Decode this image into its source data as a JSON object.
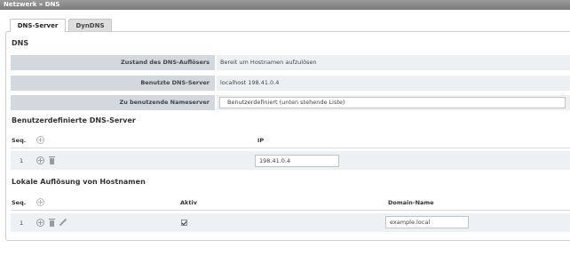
{
  "breadcrumb": "Netzwerk » DNS",
  "tabs": [
    {
      "label": "DNS-Server",
      "active": true
    },
    {
      "label": "DynDNS",
      "active": false
    }
  ],
  "dns": {
    "heading": "DNS",
    "rows": [
      {
        "label": "Zustand des DNS-Auflösers",
        "value": "Bereit um Hostnamen aufzulösen"
      },
      {
        "label": "Benutzte DNS-Server",
        "value": "localhost 198.41.0.4"
      },
      {
        "label": "Zu benutzende Nameserver",
        "value": "Benutzerdefiniert (unten stehende Liste)"
      }
    ]
  },
  "custom_servers": {
    "heading": "Benutzerdefinierte DNS-Server",
    "columns": {
      "seq": "Seq.",
      "ip": "IP"
    },
    "rows": [
      {
        "seq": "1",
        "ip": "198.41.0.4"
      }
    ]
  },
  "local_resolution": {
    "heading": "Lokale Auflösung von Hostnamen",
    "columns": {
      "seq": "Seq.",
      "active": "Aktiv",
      "domain": "Domain-Name"
    },
    "rows": [
      {
        "seq": "1",
        "active": true,
        "domain": "example.local"
      }
    ]
  },
  "colors": {
    "titlebar": "#8a8a8a",
    "label_bg": "#d2d8dd",
    "value_bg": "#edf0f2",
    "row_bg": "#eef1f3"
  }
}
